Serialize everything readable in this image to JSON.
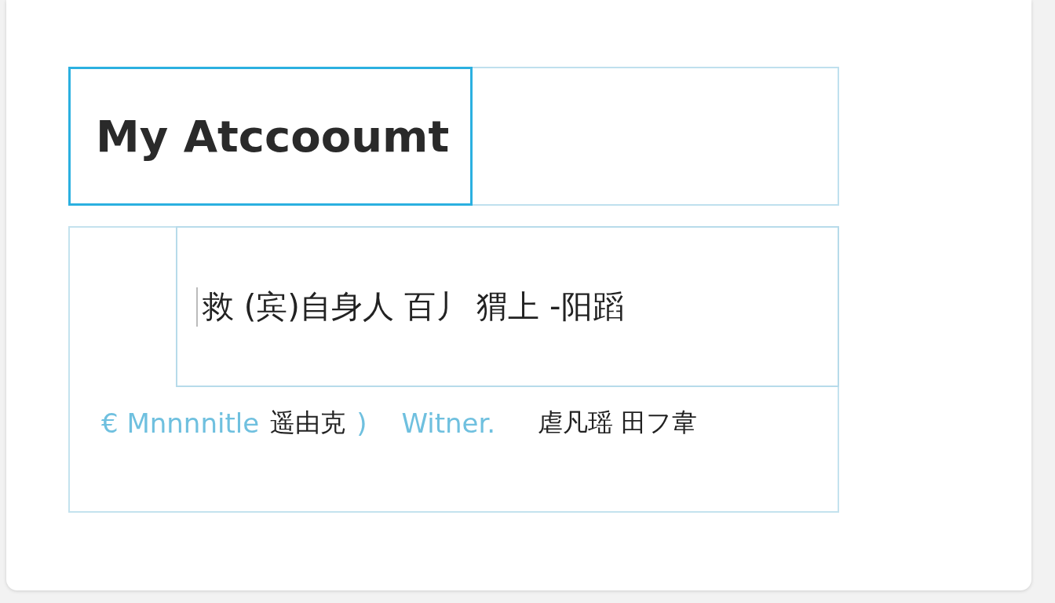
{
  "header": {
    "title": "My Atccooumt"
  },
  "field": {
    "value": "救 (宾)自身人 百丿 猬上 -阳蹈"
  },
  "info_row": [
    {
      "kind": "link",
      "text": "€ Mnnnnitle"
    },
    {
      "kind": "plain",
      "text": "遥由克"
    },
    {
      "kind": "link",
      "text": ")"
    },
    {
      "kind": "link",
      "text": "Witner."
    },
    {
      "kind": "plain",
      "text": "虐凡瑶 田フ韋"
    }
  ]
}
